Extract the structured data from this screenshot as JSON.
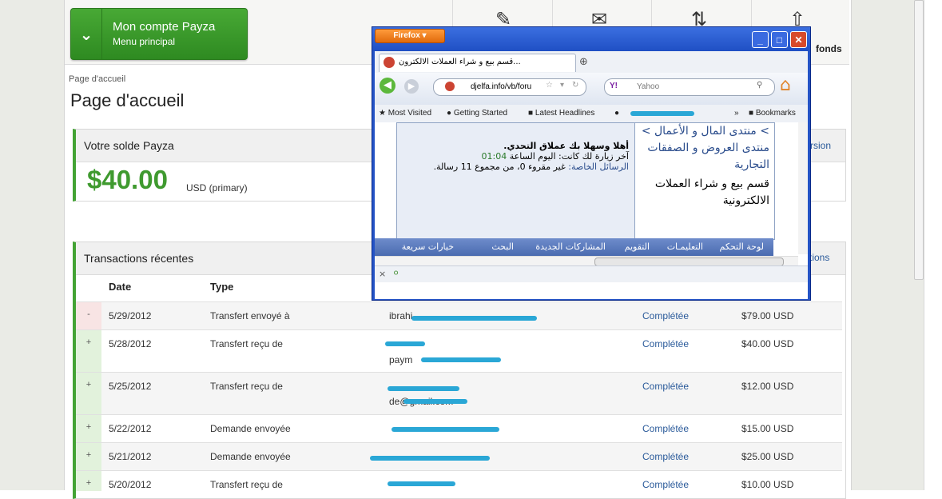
{
  "payza": {
    "account_title": "Mon compte Payza",
    "account_sub": "Menu principal",
    "nav_fonds": "fonds",
    "breadcrumb": "Page d'accueil",
    "page_title": "Page d'accueil",
    "solde_title": "Votre solde Payza",
    "solde_amount": "$40.00",
    "solde_currency": "USD (primary)",
    "solde_link": "rsion",
    "tx_title": "Transactions récentes",
    "tx_link": "tions",
    "columns": {
      "date": "Date",
      "type": "Type"
    },
    "rows": [
      {
        "sign": "-",
        "date": "5/29/2012",
        "type": "Transfert envoyé à",
        "who": "ibrahi",
        "who2": "",
        "status": "Complétée",
        "amount": "$79.00 USD"
      },
      {
        "sign": "+",
        "date": "5/28/2012",
        "type": "Transfert reçu de",
        "who": "",
        "who2": "paym",
        "status": "Complétée",
        "amount": "$40.00 USD"
      },
      {
        "sign": "+",
        "date": "5/25/2012",
        "type": "Transfert reçu de",
        "who": "",
        "who2": "de@gmail.com",
        "status": "Complétée",
        "amount": "$12.00 USD"
      },
      {
        "sign": "+",
        "date": "5/22/2012",
        "type": "Demande envoyée",
        "who": "",
        "who2": "",
        "status": "Complétée",
        "amount": "$15.00 USD"
      },
      {
        "sign": "+",
        "date": "5/21/2012",
        "type": "Demande envoyée",
        "who": "",
        "who2": "",
        "status": "Complétée",
        "amount": "$25.00 USD"
      },
      {
        "sign": "+",
        "date": "5/20/2012",
        "type": "Transfert reçu de",
        "who": "",
        "who2": "",
        "status": "Complétée",
        "amount": "$10.00 USD"
      }
    ]
  },
  "firefox": {
    "app_button": "Firefox",
    "tab_title": "قسم بيع و شراء العملات الالكترون...",
    "url": "djelfa.info/vb/foru",
    "search_placeholder": "Yahoo",
    "bookmarks": [
      "Most Visited",
      "Getting Started",
      "Latest Headlines",
      "Bookmarks"
    ],
    "forum_path": "> منتدى المال و الأعمال > منتدى العروض و الصفقات التجارية",
    "forum_current": "قسم بيع و شراء العملات الالكترونية",
    "welcome_line": "أهلا وسهلا بك عملاق التحدي.",
    "last_visit_label": "آخر زيارة لك كانت: اليوم الساعة",
    "last_visit_time": "01:04",
    "pm_label": "الرسائل الخاصة:",
    "pm_value": "غير مقروء 0، من مجموع 11 رسالة.",
    "navbar": [
      "لوحة التحكم",
      "التعليمـات",
      "التقويم",
      "المشاركات الجديدة",
      "البحث",
      "خيارات سريعة"
    ]
  }
}
